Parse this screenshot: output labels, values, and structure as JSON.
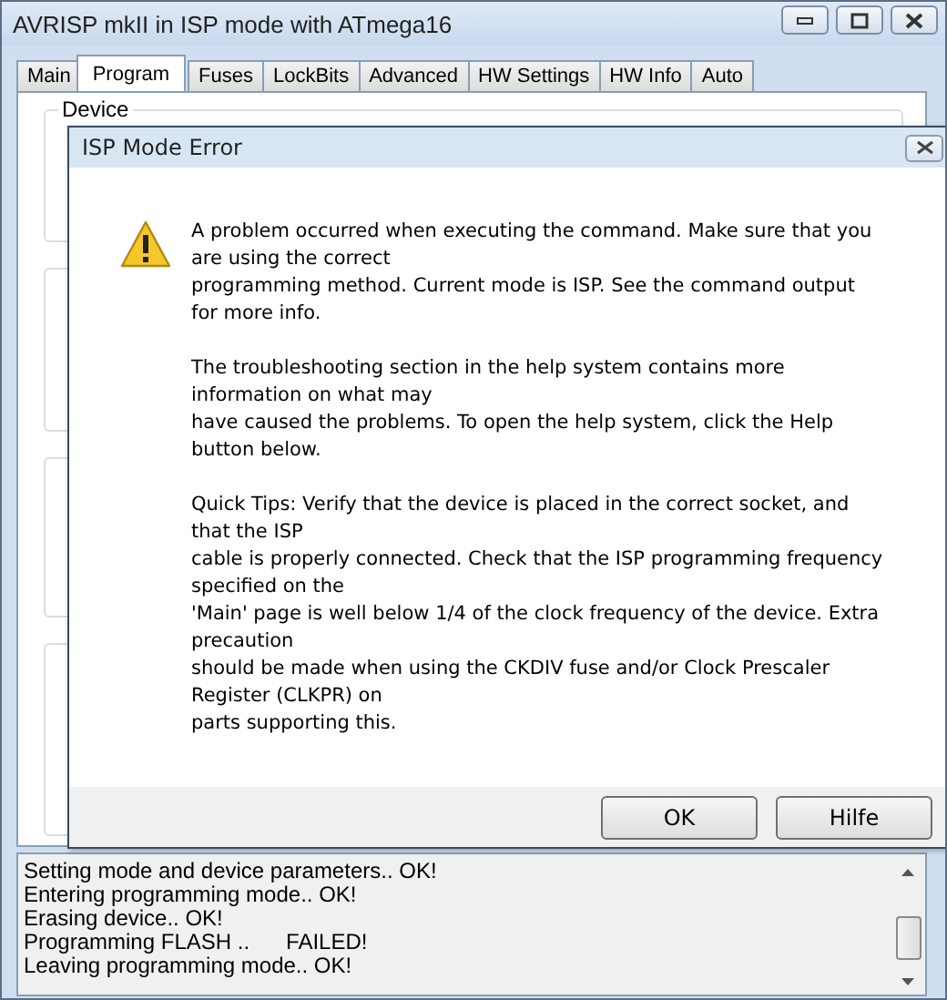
{
  "window": {
    "title": "AVRISP mkII in ISP mode with ATmega16"
  },
  "tabs": [
    {
      "label": "Main",
      "selected": false
    },
    {
      "label": "Program",
      "selected": true
    },
    {
      "label": "Fuses",
      "selected": false
    },
    {
      "label": "LockBits",
      "selected": false
    },
    {
      "label": "Advanced",
      "selected": false
    },
    {
      "label": "HW Settings",
      "selected": false
    },
    {
      "label": "HW Info",
      "selected": false
    },
    {
      "label": "Auto",
      "selected": false
    }
  ],
  "group": {
    "label": "Device"
  },
  "dialog": {
    "title": "ISP Mode Error",
    "paragraphs": [
      "A problem occurred when executing the command. Make sure that you\nare using the correct\nprogramming method. Current mode is ISP. See the command output\nfor more info.",
      "The troubleshooting section in the help system contains more\ninformation on what may\nhave caused the problems. To open the help system, click the Help\nbutton below.",
      "Quick Tips: Verify that the device is placed in the correct socket, and\nthat the ISP\ncable is properly connected. Check that the ISP programming frequency\nspecified on the\n'Main' page is well below 1/4 of the clock frequency of the device. Extra\nprecaution\nshould be made when using the CKDIV fuse and/or Clock Prescaler\nRegister (CLKPR) on\nparts supporting this."
    ],
    "buttons": [
      "OK",
      "Hilfe"
    ]
  },
  "log": [
    "Setting mode and device parameters.. OK!",
    "Entering programming mode.. OK!",
    "Erasing device.. OK!",
    "Programming FLASH ..      FAILED!",
    "Leaving programming mode.. OK!"
  ]
}
